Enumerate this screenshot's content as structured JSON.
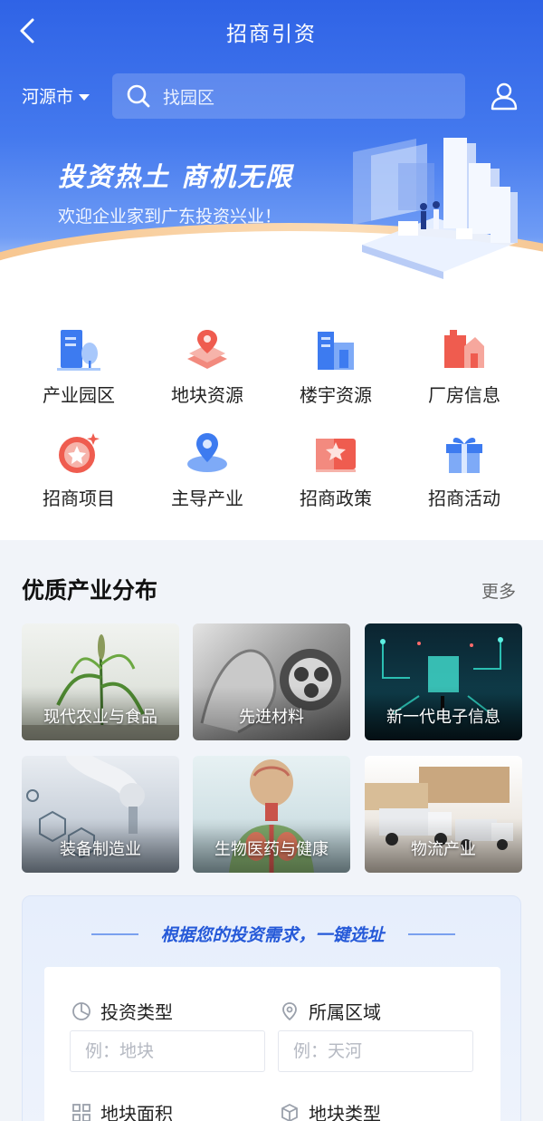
{
  "header": {
    "title": "招商引资",
    "city": "河源市",
    "search_placeholder": "找园区"
  },
  "banner": {
    "title": "投资热土 商机无限",
    "subtitle": "欢迎企业家到广东投资兴业！"
  },
  "grid": [
    {
      "label": "产业园区",
      "icon": "industrial-park-icon"
    },
    {
      "label": "地块资源",
      "icon": "land-plot-icon"
    },
    {
      "label": "楼宇资源",
      "icon": "building-icon"
    },
    {
      "label": "厂房信息",
      "icon": "factory-icon"
    },
    {
      "label": "招商项目",
      "icon": "project-icon"
    },
    {
      "label": "主导产业",
      "icon": "leading-industry-icon"
    },
    {
      "label": "招商政策",
      "icon": "policy-icon"
    },
    {
      "label": "招商活动",
      "icon": "gift-icon"
    }
  ],
  "industries": {
    "title": "优质产业分布",
    "more": "更多",
    "items": [
      {
        "label": "现代农业与食品"
      },
      {
        "label": "先进材料"
      },
      {
        "label": "新一代电子信息"
      },
      {
        "label": "装备制造业"
      },
      {
        "label": "生物医药与健康"
      },
      {
        "label": "物流产业"
      }
    ]
  },
  "selector": {
    "heading": "根据您的投资需求，一键选址",
    "fields": [
      {
        "label": "投资类型",
        "placeholder": "例：地块",
        "icon": "pie-chart-icon"
      },
      {
        "label": "所属区域",
        "placeholder": "例：天河",
        "icon": "location-pin-icon"
      },
      {
        "label": "地块面积",
        "icon": "grid-icon"
      },
      {
        "label": "地块类型",
        "icon": "cube-icon"
      }
    ]
  },
  "colors": {
    "brand": "#2f63e6",
    "accent_orange": "#f6c38b",
    "heading_blue": "#2559d8"
  }
}
